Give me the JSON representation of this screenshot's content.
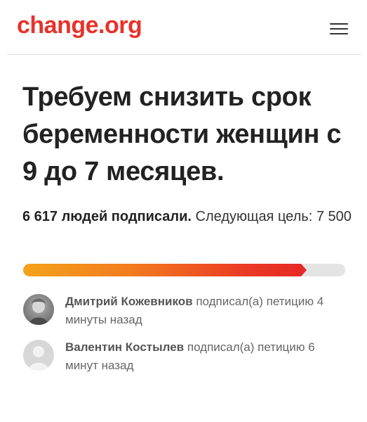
{
  "header": {
    "logo": "change.org",
    "menu_icon": "hamburger-menu-icon"
  },
  "petition": {
    "title": "Требуем снизить срок беременности женщин с 9 до 7 месяцев.",
    "signed_count_text": "6 617 людей подписали.",
    "next_goal_text": "Следующая цель: 7 500",
    "signed_count": 6617,
    "goal": 7500,
    "progress_fraction": 0.88
  },
  "colors": {
    "brand": "#e8322a",
    "progress_start": "#f4a21c",
    "progress_end": "#e52a25",
    "track": "#e4e4e4"
  },
  "recent_signers": [
    {
      "name": "Дмитрий Кожевников",
      "action": "подписал(а) петицию 4 минуты назад",
      "avatar": "user-photo-avatar"
    },
    {
      "name": "Валентин Костылев",
      "action": "подписал(а) петицию 6 минут назад",
      "avatar": "default-user-avatar-icon"
    }
  ]
}
